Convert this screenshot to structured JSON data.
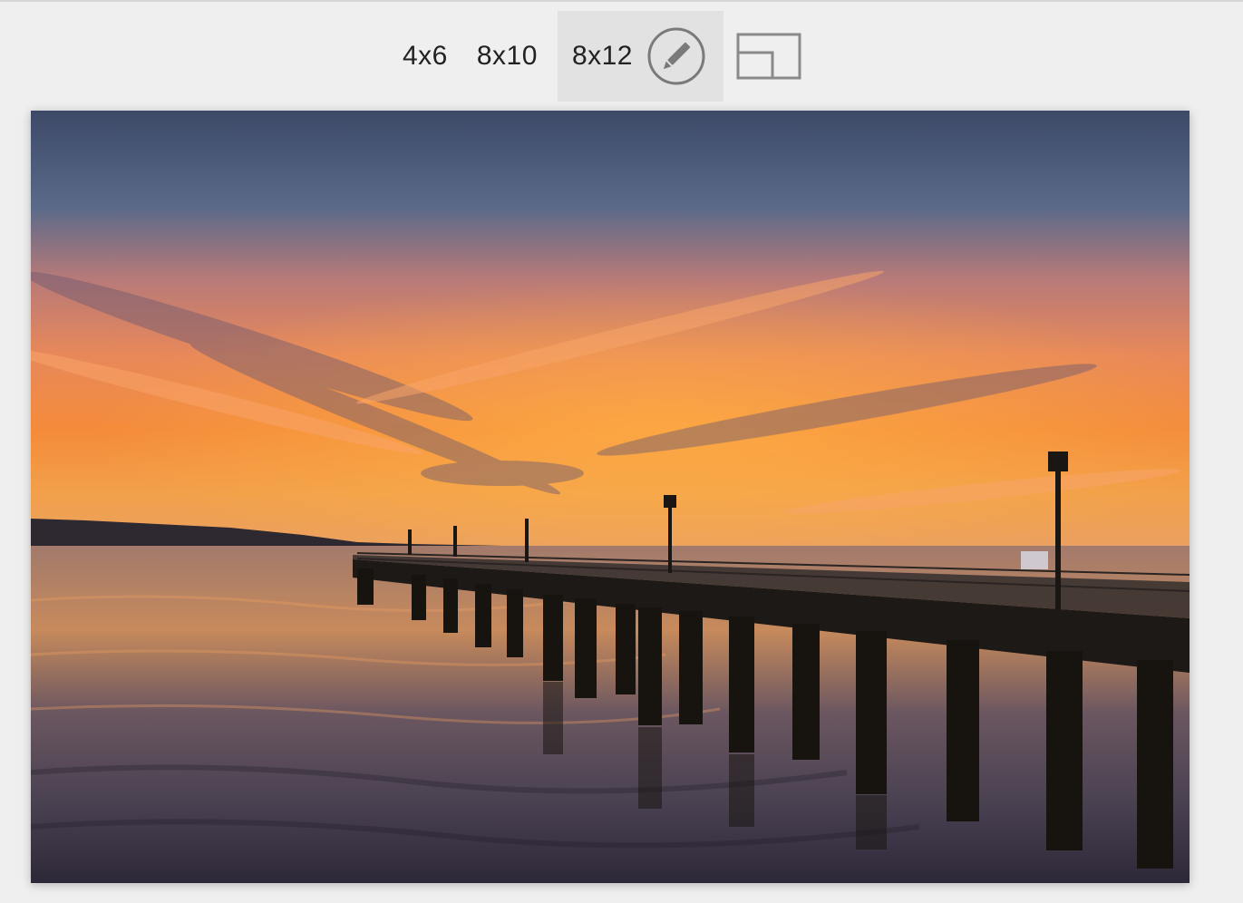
{
  "print_sizes": {
    "options": [
      {
        "label": "4x6",
        "selected": false
      },
      {
        "label": "8x10",
        "selected": false
      },
      {
        "label": "8x12",
        "selected": true
      }
    ]
  },
  "toolbar": {
    "edit_icon": "pencil-icon",
    "orientation_icon": "orientation-toggle-icon"
  },
  "photo": {
    "subject": "sunset-over-pier",
    "colors": {
      "sky_top": "#3f4d6b",
      "sky_mid": "#d9784a",
      "horizon": "#f28a2e",
      "water": "#3a3446",
      "pier": "#1b1714"
    }
  }
}
